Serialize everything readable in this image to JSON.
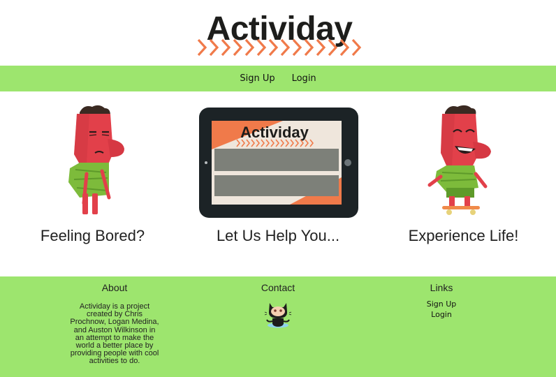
{
  "header": {
    "title": "Actividay"
  },
  "nav": {
    "items": [
      {
        "label": "Sign Up"
      },
      {
        "label": "Login"
      }
    ]
  },
  "hero": {
    "columns": [
      {
        "tagline": "Feeling Bored?"
      },
      {
        "tagline": "Let Us Help You...",
        "screen_title": "Actividay"
      },
      {
        "tagline": "Experience Life!"
      }
    ]
  },
  "footer": {
    "about": {
      "heading": "About",
      "text": "Actividay is a project created by Chris Prochnow, Logan Medina, and Auston Wilkinson in an attempt to make the world a better place by providing people with cool activities to do."
    },
    "contact": {
      "heading": "Contact",
      "icon": "github-octocat-icon"
    },
    "links": {
      "heading": "Links",
      "items": [
        {
          "label": "Sign Up"
        },
        {
          "label": "Login"
        }
      ]
    }
  },
  "colors": {
    "accent_green": "#9de56e",
    "chevron_orange": "#f07a4a",
    "character_red": "#e2404a",
    "tablet_frame": "#1c2326"
  }
}
